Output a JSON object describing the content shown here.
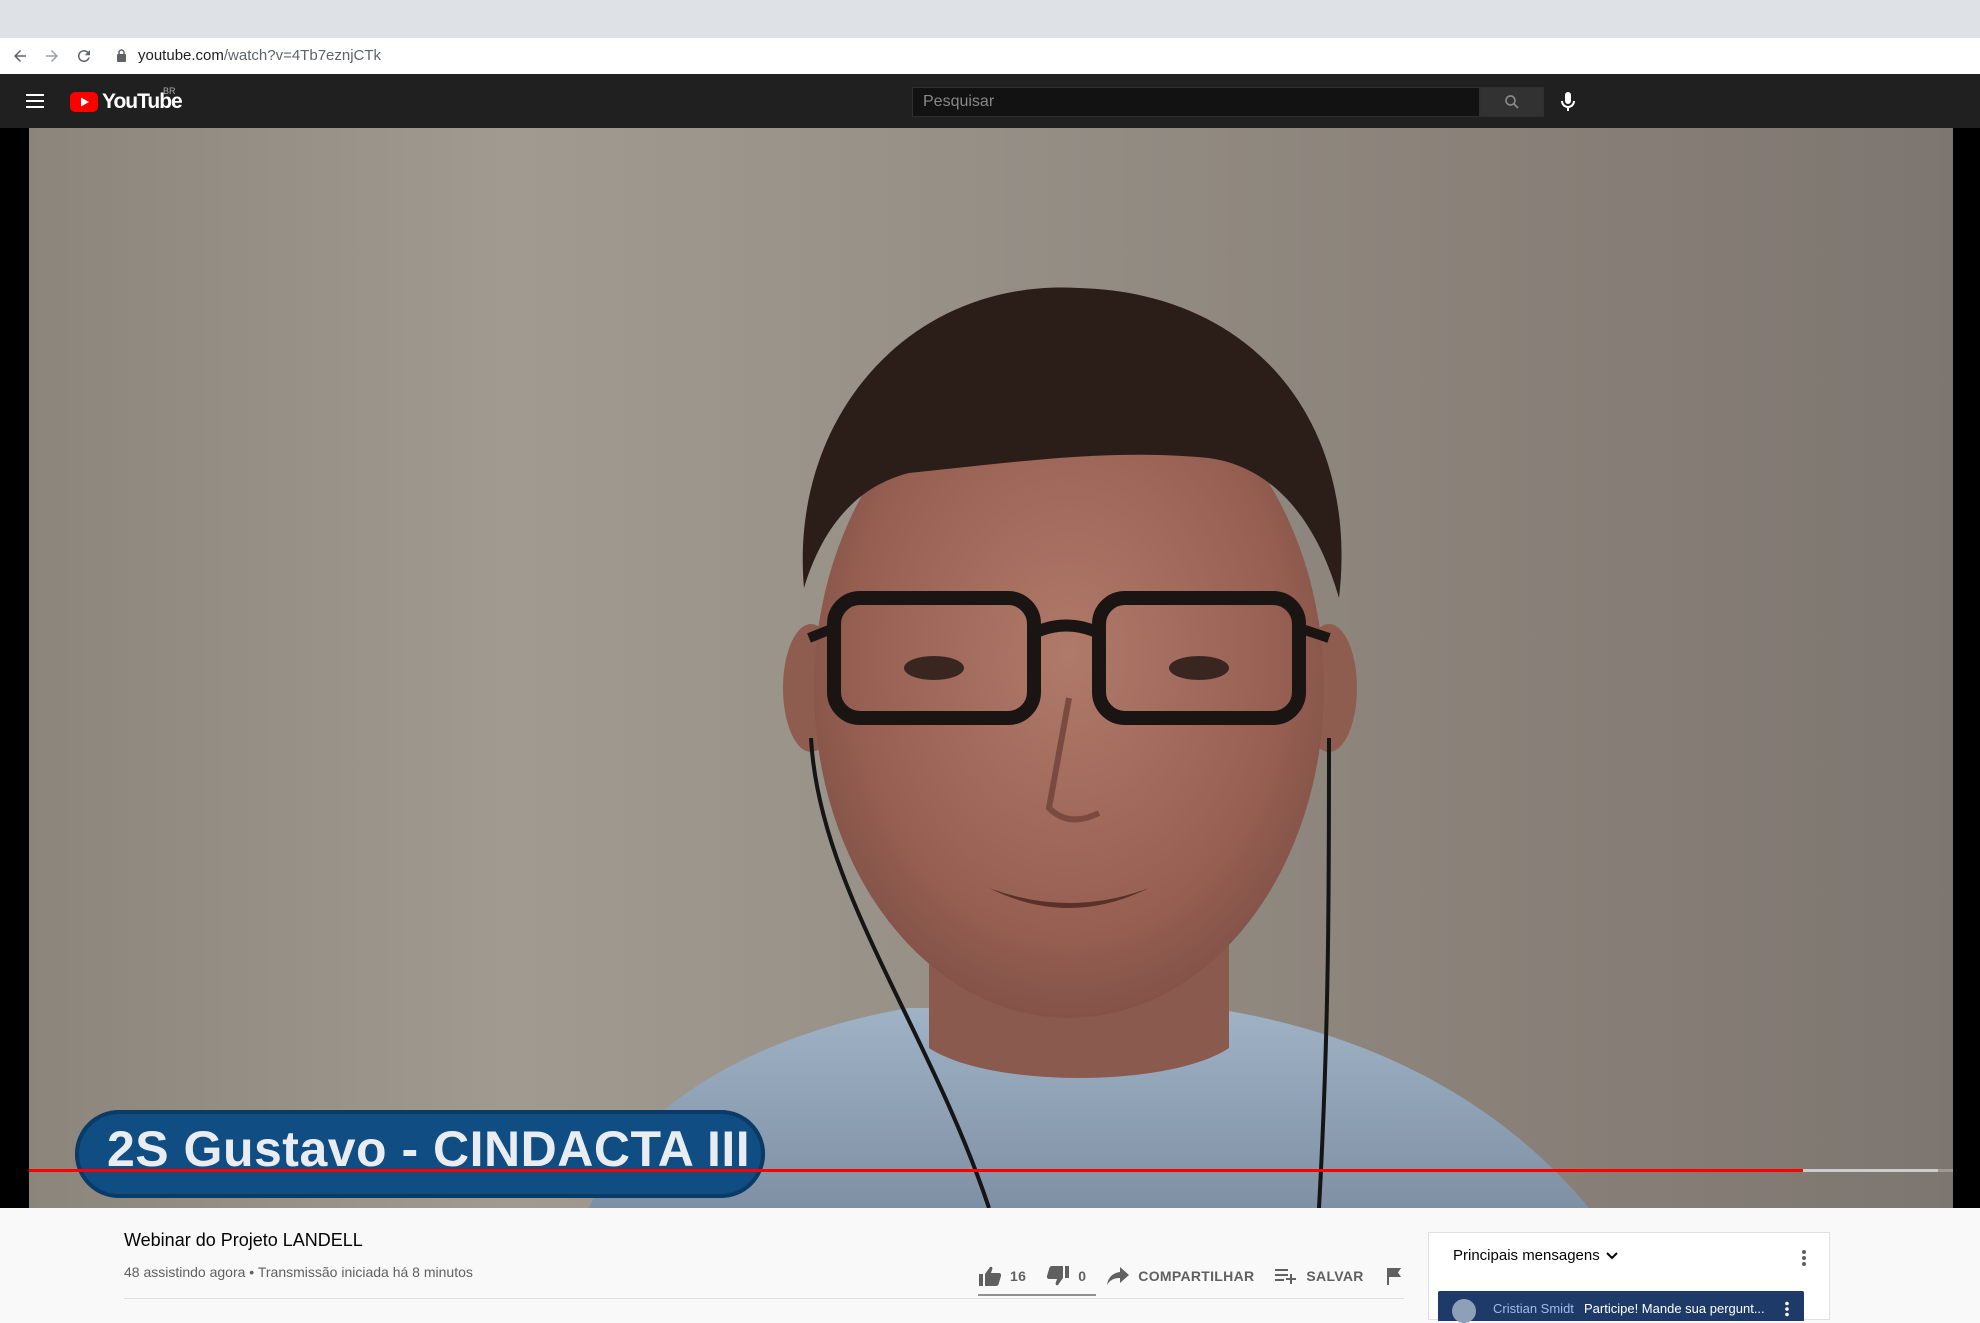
{
  "browser": {
    "url_host": "youtube.com",
    "url_path": "/watch?v=4Tb7eznjCTk"
  },
  "header": {
    "logo_text": "YouTube",
    "country_code": "BR",
    "search_placeholder": "Pesquisar"
  },
  "video": {
    "lower_third": "2S Gustavo - CINDACTA III",
    "progress": 0.922
  },
  "info": {
    "title": "Webinar do Projeto LANDELL",
    "meta": "48 assistindo agora • Transmissão iniciada há 8 minutos",
    "likes": "16",
    "dislikes": "0",
    "share_label": "COMPARTILHAR",
    "save_label": "SALVAR"
  },
  "chat": {
    "title": "Principais mensagens",
    "pinned_author": "Cristian Smidt",
    "pinned_message": "Participe! Mande sua pergunt..."
  },
  "colors": {
    "accent": "#ff0000",
    "header_bg": "#202020",
    "lower_third_bg": "#0f4d82"
  }
}
